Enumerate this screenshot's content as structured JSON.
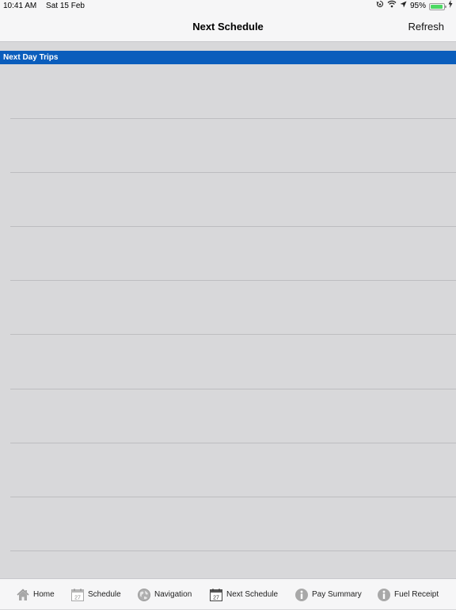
{
  "status_bar": {
    "time": "10:41 AM",
    "date": "Sat 15 Feb",
    "battery": "95%",
    "battery_level": 0.95
  },
  "nav": {
    "title": "Next Schedule",
    "refresh_label": "Refresh"
  },
  "section": {
    "header": "Next Day Trips"
  },
  "tabs": [
    {
      "label": "Home",
      "icon": "home-icon"
    },
    {
      "label": "Schedule",
      "icon": "calendar-icon",
      "day": "27"
    },
    {
      "label": "Navigation",
      "icon": "globe-icon"
    },
    {
      "label": "Next Schedule",
      "icon": "calendar-icon",
      "day": "27"
    },
    {
      "label": "Pay Summary",
      "icon": "info-icon"
    },
    {
      "label": "Fuel Receipt",
      "icon": "info-icon"
    }
  ],
  "colors": {
    "accent": "#0a5dbc",
    "background": "#d8d8da",
    "bar": "#f6f6f7"
  }
}
